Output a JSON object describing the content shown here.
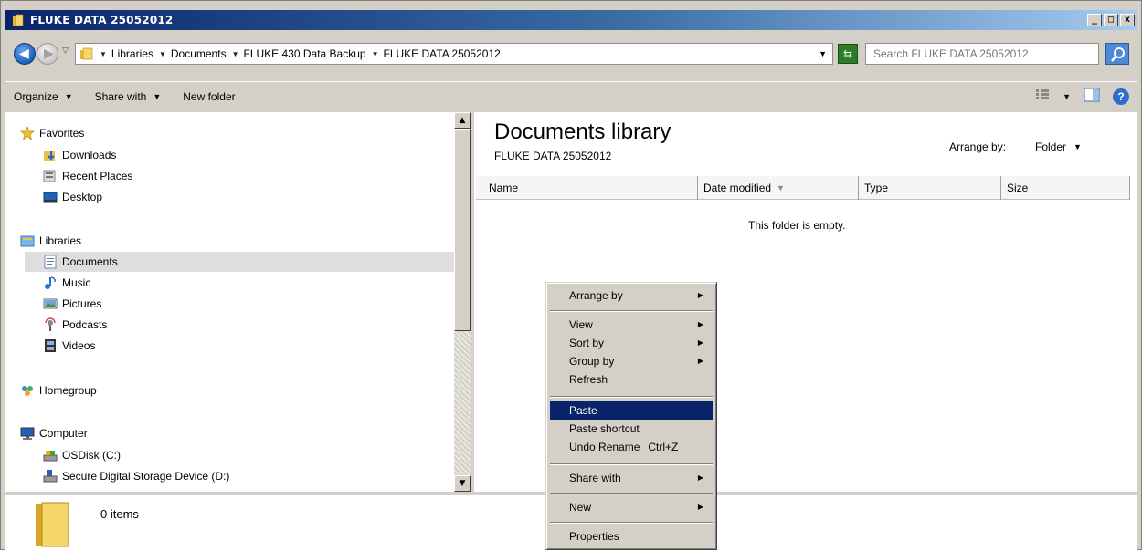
{
  "window": {
    "title": "FLUKE DATA 25052012"
  },
  "address": {
    "crumbs": [
      "Libraries",
      "Documents",
      "FLUKE 430 Data Backup",
      "FLUKE DATA 25052012"
    ],
    "search_placeholder": "Search FLUKE DATA 25052012"
  },
  "toolbar": {
    "organize": "Organize",
    "share_with": "Share with",
    "new_folder": "New folder"
  },
  "nav": {
    "favorites": "Favorites",
    "downloads": "Downloads",
    "recent_places": "Recent Places",
    "desktop": "Desktop",
    "libraries": "Libraries",
    "documents": "Documents",
    "music": "Music",
    "pictures": "Pictures",
    "podcasts": "Podcasts",
    "videos": "Videos",
    "homegroup": "Homegroup",
    "computer": "Computer",
    "osdisk": "OSDisk (C:)",
    "sd_device": "Secure Digital Storage Device (D:)"
  },
  "content": {
    "library_title": "Documents library",
    "subtitle": "FLUKE DATA 25052012",
    "arrange_label": "Arrange by:",
    "arrange_value": "Folder",
    "columns": [
      "Name",
      "Date modified",
      "Type",
      "Size"
    ],
    "empty_message": "This folder is empty."
  },
  "status": {
    "item_count": "0 items"
  },
  "context_menu": {
    "arrange_by": "Arrange by",
    "view": "View",
    "sort_by": "Sort by",
    "group_by": "Group by",
    "refresh": "Refresh",
    "paste": "Paste",
    "paste_shortcut": "Paste shortcut",
    "undo_rename": "Undo Rename",
    "undo_rename_shortcut": "Ctrl+Z",
    "share_with": "Share with",
    "new": "New",
    "properties": "Properties"
  },
  "colors": {
    "title_active": "#0a246a",
    "menu_highlight": "#0a246a",
    "chrome": "#d4d0c8"
  }
}
